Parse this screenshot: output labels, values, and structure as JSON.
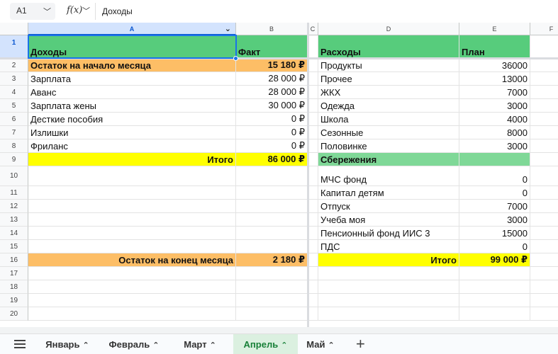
{
  "formula_bar": {
    "cell_ref": "A1",
    "fx_label": "f(x)",
    "value": "Доходы"
  },
  "columns": [
    "A",
    "B",
    "C",
    "D",
    "E",
    "F"
  ],
  "rows": [
    "1",
    "2",
    "3",
    "4",
    "5",
    "6",
    "7",
    "8",
    "9",
    "10",
    "11",
    "12",
    "13",
    "14",
    "15",
    "16",
    "17",
    "18",
    "19",
    "20"
  ],
  "cells": {
    "A1": "Доходы",
    "B1": "Факт",
    "D1": "Расходы",
    "E1": "План",
    "A2": "Остаток на начало  месяца",
    "B2": "15 180 ₽",
    "A3": "Зарплата",
    "B3": "28 000 ₽",
    "A4": "Аванс",
    "B4": "28 000 ₽",
    "A5": "Зарплата жены",
    "B5": "30 000 ₽",
    "A6": "Десткие пособия",
    "B6": "0 ₽",
    "A7": "Излишки",
    "B7": "0 ₽",
    "A8": "Фриланс",
    "B8": "0 ₽",
    "A9": "Итого",
    "B9": "86 000 ₽",
    "A16": "Остаток на конец месяца",
    "B16": "2 180 ₽",
    "D2": "Продукты",
    "E2": "36000",
    "D3": "Прочее",
    "E3": "13000",
    "D4": "ЖКХ",
    "E4": "7000",
    "D5": "Одежда",
    "E5": "3000",
    "D6": "Школа",
    "E6": "4000",
    "D7": "Сезонные",
    "E7": "8000",
    "D8": "Половинке",
    "E8": "3000",
    "D9": "Сбережения",
    "D10": "МЧС фонд",
    "E10": "0",
    "D11": "Капитал детям",
    "E11": "0",
    "D12": "Отпуск",
    "E12": "7000",
    "D13": "Учеба моя",
    "E13": "3000",
    "D14": "Пенсионный фонд ИИС 3",
    "E14": "15000",
    "D15": "ПДС",
    "E15": "0",
    "D16": "Итого",
    "E16": "99 000 ₽"
  },
  "colors": {
    "header_green": "#57cc7c",
    "savings_green": "#7fd897",
    "orange": "#fdbe66",
    "yellow": "#ffff00",
    "selection_blue": "#1a73e8",
    "active_tab_green": "#188038"
  },
  "sheet_tabs": [
    {
      "label": "Январь",
      "active": false
    },
    {
      "label": "Февраль",
      "active": false
    },
    {
      "label": "Март",
      "active": false
    },
    {
      "label": "Апрель",
      "active": true
    },
    {
      "label": "Май",
      "active": false
    }
  ],
  "icons": {
    "menu": "menu-icon",
    "add_sheet": "plus-icon",
    "tab_menu": "chevron-up-icon",
    "namebox_dropdown": "chevron-down-icon",
    "column_dropdown": "chevron-down-icon"
  }
}
